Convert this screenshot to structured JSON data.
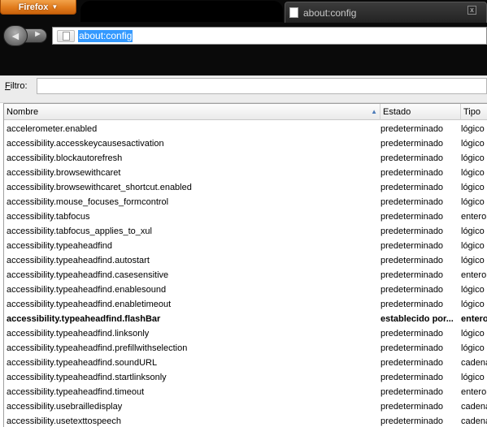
{
  "browser": {
    "menu_button_label": "Firefox",
    "menu_button_caret": "▼",
    "tab_title": "about:config",
    "tab_close_glyph": "x",
    "url": "about:config",
    "back_glyph": "◄",
    "forward_glyph": "►"
  },
  "filter": {
    "label_prefix": "F",
    "label_rest": "iltro:",
    "value": ""
  },
  "table": {
    "columns": {
      "name": "Nombre",
      "state": "Estado",
      "type": "Tipo"
    },
    "sort_glyph": "▲",
    "rows": [
      {
        "name": "accelerometer.enabled",
        "state": "predeterminado",
        "type": "lógico"
      },
      {
        "name": "accessibility.accesskeycausesactivation",
        "state": "predeterminado",
        "type": "lógico"
      },
      {
        "name": "accessibility.blockautorefresh",
        "state": "predeterminado",
        "type": "lógico"
      },
      {
        "name": "accessibility.browsewithcaret",
        "state": "predeterminado",
        "type": "lógico"
      },
      {
        "name": "accessibility.browsewithcaret_shortcut.enabled",
        "state": "predeterminado",
        "type": "lógico"
      },
      {
        "name": "accessibility.mouse_focuses_formcontrol",
        "state": "predeterminado",
        "type": "lógico"
      },
      {
        "name": "accessibility.tabfocus",
        "state": "predeterminado",
        "type": "entero"
      },
      {
        "name": "accessibility.tabfocus_applies_to_xul",
        "state": "predeterminado",
        "type": "lógico"
      },
      {
        "name": "accessibility.typeaheadfind",
        "state": "predeterminado",
        "type": "lógico"
      },
      {
        "name": "accessibility.typeaheadfind.autostart",
        "state": "predeterminado",
        "type": "lógico"
      },
      {
        "name": "accessibility.typeaheadfind.casesensitive",
        "state": "predeterminado",
        "type": "entero"
      },
      {
        "name": "accessibility.typeaheadfind.enablesound",
        "state": "predeterminado",
        "type": "lógico"
      },
      {
        "name": "accessibility.typeaheadfind.enabletimeout",
        "state": "predeterminado",
        "type": "lógico"
      },
      {
        "name": "accessibility.typeaheadfind.flashBar",
        "state": "establecido por...",
        "type": "entero",
        "modified": true
      },
      {
        "name": "accessibility.typeaheadfind.linksonly",
        "state": "predeterminado",
        "type": "lógico"
      },
      {
        "name": "accessibility.typeaheadfind.prefillwithselection",
        "state": "predeterminado",
        "type": "lógico"
      },
      {
        "name": "accessibility.typeaheadfind.soundURL",
        "state": "predeterminado",
        "type": "cadena"
      },
      {
        "name": "accessibility.typeaheadfind.startlinksonly",
        "state": "predeterminado",
        "type": "lógico"
      },
      {
        "name": "accessibility.typeaheadfind.timeout",
        "state": "predeterminado",
        "type": "entero"
      },
      {
        "name": "accessibility.usebrailledisplay",
        "state": "predeterminado",
        "type": "cadena"
      },
      {
        "name": "accessibility.usetexttospeech",
        "state": "predeterminado",
        "type": "cadena"
      }
    ]
  }
}
